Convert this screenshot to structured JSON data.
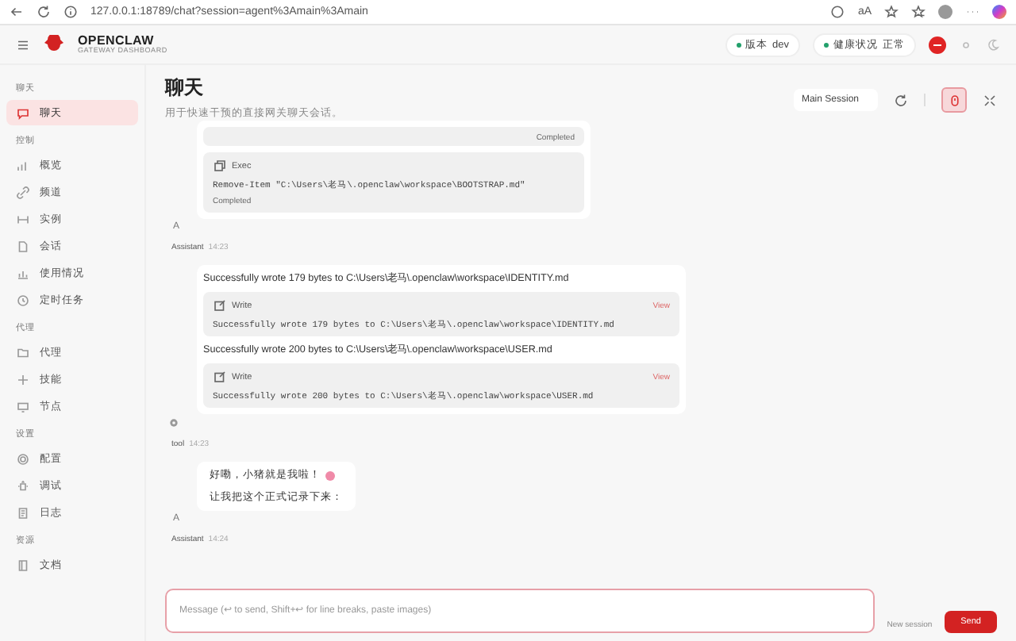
{
  "browser": {
    "url": "127.0.0.1:18789/chat?session=agent%3Amain%3Amain",
    "font_button": "aA"
  },
  "header": {
    "brand": "OPENCLAW",
    "tagline": "GATEWAY DASHBOARD",
    "pills": [
      {
        "label": "版本",
        "value": "dev",
        "color": "#22a06b"
      },
      {
        "label": "健康状况",
        "value": "正常",
        "color": "#22a06b"
      }
    ]
  },
  "sidebar": {
    "groups": [
      {
        "title": "聊天",
        "items": [
          {
            "label": "聊天",
            "selected": true
          }
        ]
      },
      {
        "title": "控制",
        "items": [
          {
            "label": "概览",
            "selected": false
          },
          {
            "label": "频道",
            "selected": false
          },
          {
            "label": "实例",
            "selected": false
          },
          {
            "label": "会话",
            "selected": false
          },
          {
            "label": "使用情况",
            "selected": false
          },
          {
            "label": "定时任务",
            "selected": false
          }
        ]
      },
      {
        "title": "代理",
        "items": [
          {
            "label": "代理",
            "selected": false
          },
          {
            "label": "技能",
            "selected": false
          },
          {
            "label": "节点",
            "selected": false
          }
        ]
      },
      {
        "title": "设置",
        "items": [
          {
            "label": "配置",
            "selected": false
          },
          {
            "label": "调试",
            "selected": false
          },
          {
            "label": "日志",
            "selected": false
          }
        ]
      },
      {
        "title": "资源",
        "items": [
          {
            "label": "文档",
            "selected": false
          }
        ]
      }
    ]
  },
  "page": {
    "title": "聊天",
    "subtitle": "用于快速干预的直接网关聊天会话。",
    "session": "Main Session"
  },
  "messages": [
    {
      "kind": "tools",
      "cards": [
        {
          "kind": "result",
          "status": "Completed"
        },
        {
          "kind": "exec",
          "name": "Exec",
          "command": "Remove-Item \"C:\\Users\\老马\\.openclaw\\workspace\\BOOTSTRAP.md\"",
          "status": "Completed"
        }
      ],
      "avatar": "A",
      "sender": "Assistant",
      "time": "14:23"
    },
    {
      "kind": "writes",
      "entries": [
        {
          "text": "Successfully wrote 179 bytes to C:\\Users\\老马\\.openclaw\\workspace\\IDENTITY.md",
          "tool": "Write",
          "view": "View",
          "output": "Successfully wrote 179 bytes to C:\\Users\\老马\\.openclaw\\workspace\\IDENTITY.md"
        },
        {
          "text": "Successfully wrote 200 bytes to C:\\Users\\老马\\.openclaw\\workspace\\USER.md",
          "tool": "Write",
          "view": "View",
          "output": "Successfully wrote 200 bytes to C:\\Users\\老马\\.openclaw\\workspace\\USER.md"
        }
      ],
      "sender": "tool",
      "time": "14:23"
    },
    {
      "kind": "text",
      "lines": [
        "好嘞，小猪就是我啦！",
        "让我把这个正式记录下来："
      ],
      "avatar": "A",
      "sender": "Assistant",
      "time": "14:24"
    }
  ],
  "composer": {
    "placeholder": "Message (↩ to send, Shift+↩ for line breaks, paste images)",
    "new_session": "New session",
    "send": "Send"
  }
}
